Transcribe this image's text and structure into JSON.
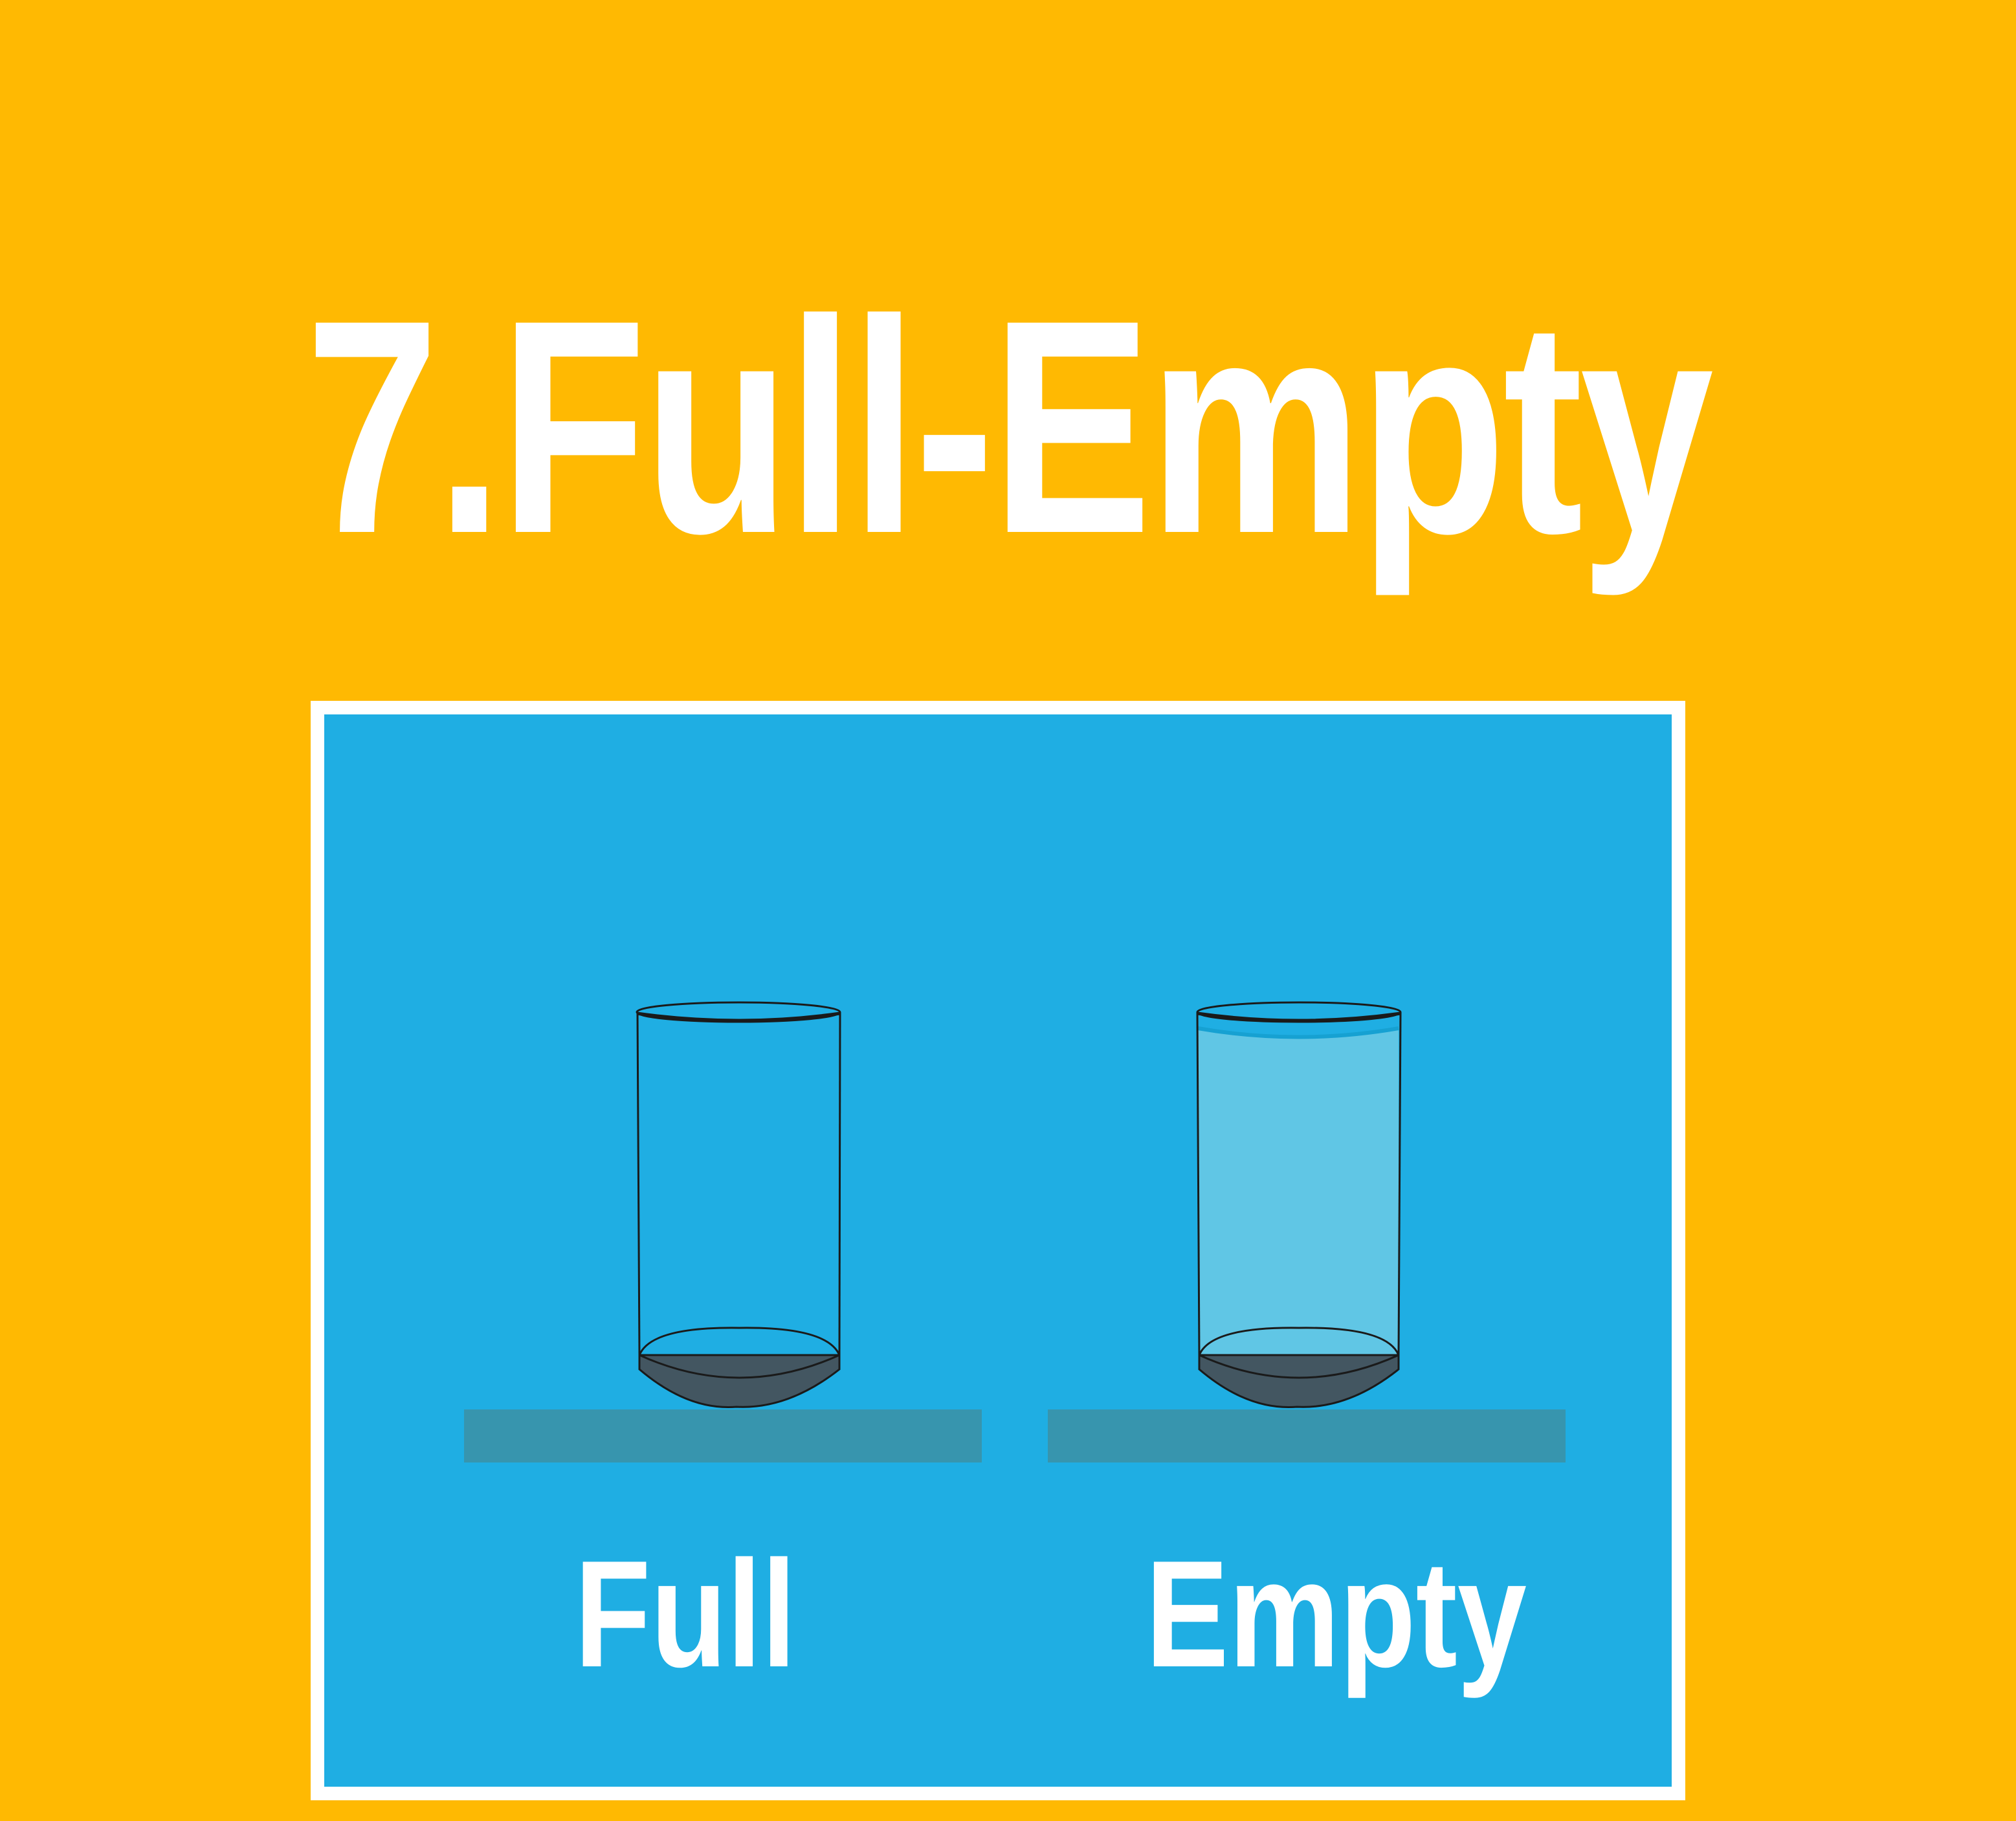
{
  "title": "7.Full-Empty",
  "colors": {
    "background": "#FFB902",
    "panel": "#1FAEE3",
    "panel_border": "#FFFFFF",
    "shelf": "#3795AE",
    "water": "#60C6E5",
    "glass_base": "#435661",
    "outline": "#1A1A1A",
    "text": "#FFFFFF"
  },
  "glasses": [
    {
      "label": "Full",
      "icon": "empty-glass-icon",
      "fill_level": 0
    },
    {
      "label": "Empty",
      "icon": "water-filled-glass-icon",
      "fill_level": 0.95
    }
  ]
}
